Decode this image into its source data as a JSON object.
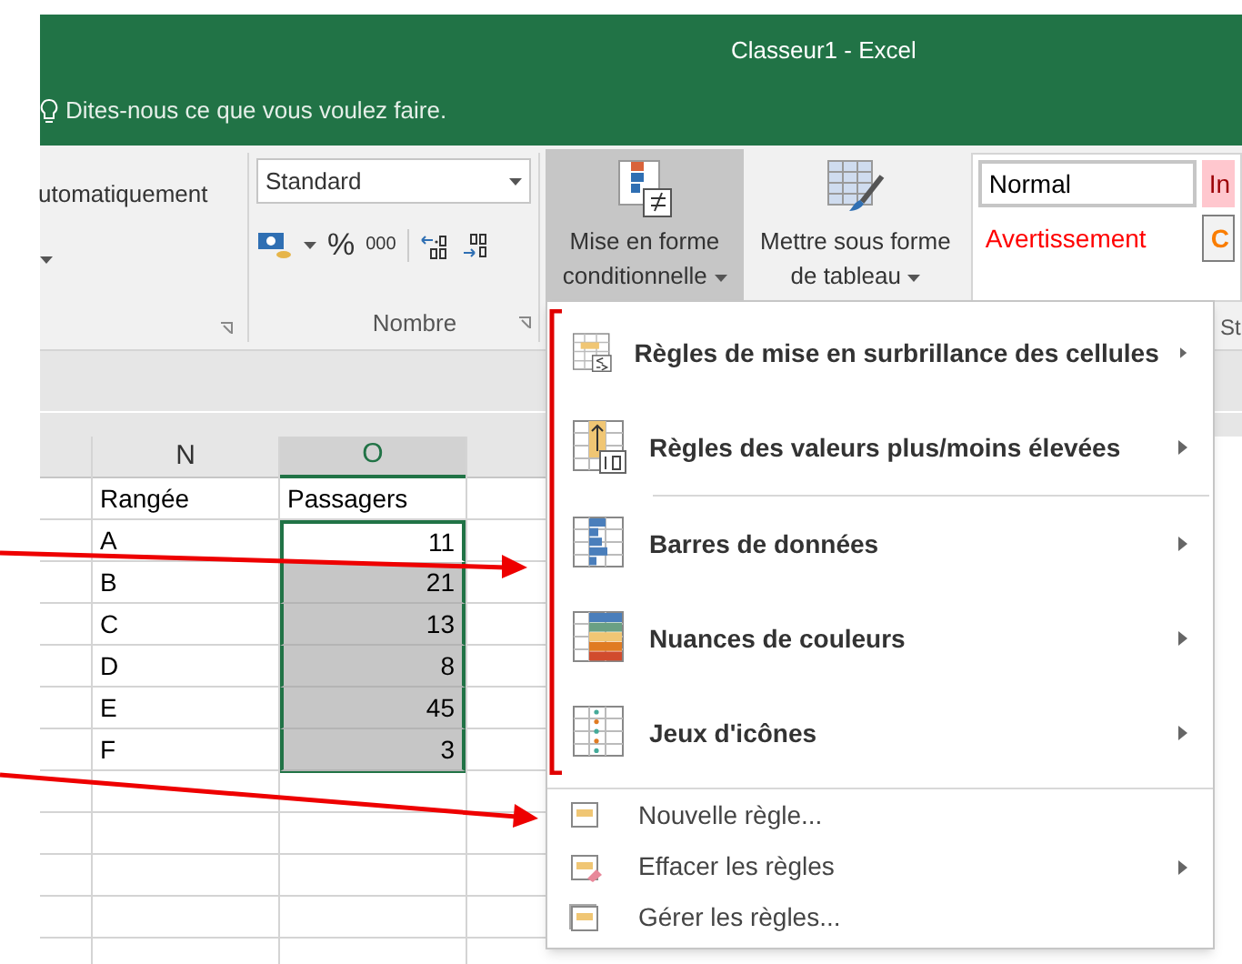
{
  "window": {
    "title": "Classeur1 - Excel"
  },
  "tell_me": {
    "placeholder": "Dites-nous ce que vous voulez faire."
  },
  "ribbon": {
    "wrap_text_fragment": "utomatiquement",
    "number_format": {
      "value": "Standard"
    },
    "number_buttons": [
      "%",
      "000"
    ],
    "number_group_label": "Nombre",
    "cf_button": {
      "label_lines": [
        "Mise en forme",
        "conditionnelle"
      ],
      "selected": true
    },
    "table_button": {
      "label_lines": [
        "Mettre sous forme",
        "de tableau"
      ],
      "selected": false
    },
    "styles": [
      {
        "label": "Normal",
        "kind": "normal"
      },
      {
        "label": "In",
        "kind": "bad"
      },
      {
        "label": "Avertissement",
        "kind": "warning"
      },
      {
        "label": "C",
        "kind": "calc"
      }
    ],
    "styles_group_label": "St"
  },
  "sheet": {
    "columns": [
      {
        "label": "N",
        "selected": false
      },
      {
        "label": "O",
        "selected": true
      }
    ],
    "header_row": [
      "Rangée",
      "Passagers"
    ],
    "rows": [
      {
        "label": "A",
        "value": "11",
        "highlighted": false
      },
      {
        "label": "B",
        "value": "21",
        "highlighted": true
      },
      {
        "label": "C",
        "value": "13",
        "highlighted": true
      },
      {
        "label": "D",
        "value": "8",
        "highlighted": true
      },
      {
        "label": "E",
        "value": "45",
        "highlighted": true
      },
      {
        "label": "F",
        "value": "3",
        "highlighted": true
      }
    ]
  },
  "menu": {
    "large_items": [
      {
        "label": "Règles de mise en surbrillance des cellules",
        "submenu": true
      },
      {
        "label": "Règles des valeurs plus/moins élevées",
        "submenu": true
      },
      {
        "label": "Barres de données",
        "submenu": true
      },
      {
        "label": "Nuances de couleurs",
        "submenu": true
      },
      {
        "label": "Jeux d'icônes",
        "submenu": true
      }
    ],
    "small_items": [
      {
        "label": "Nouvelle règle...",
        "submenu": false
      },
      {
        "label": "Effacer les règles",
        "submenu": true
      },
      {
        "label": "Gérer les règles...",
        "submenu": false
      }
    ]
  }
}
